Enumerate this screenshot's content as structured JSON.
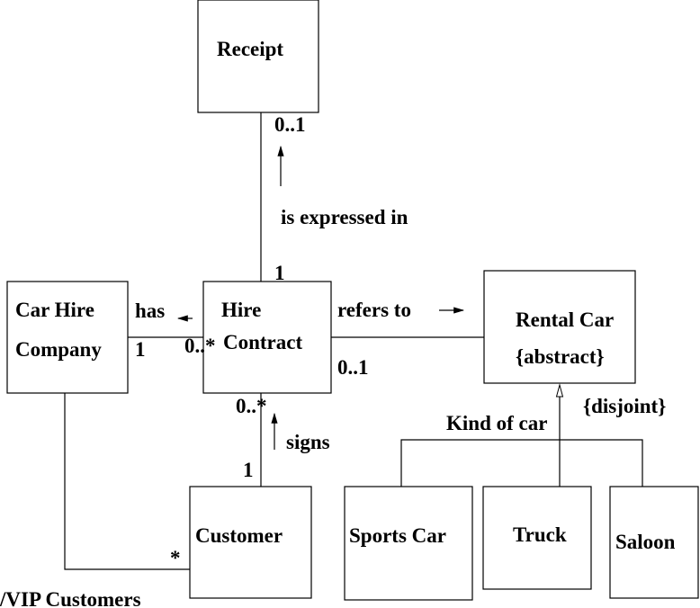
{
  "classes": {
    "receipt": "Receipt",
    "car_hire_company": [
      "Car Hire",
      "Company"
    ],
    "hire_contract": [
      "Hire",
      "Contract"
    ],
    "rental_car": [
      "Rental Car",
      "{abstract}"
    ],
    "customer": "Customer",
    "sports_car": "Sports Car",
    "truck": "Truck",
    "saloon": "Saloon"
  },
  "associations": {
    "expressed": {
      "label": "is expressed in",
      "receipt_mult": "0..1",
      "contract_mult": "1"
    },
    "has": {
      "label": "has",
      "company_mult": "1",
      "contract_mult": "0..*"
    },
    "refers": {
      "label": "refers to",
      "car_mult": "0..1"
    },
    "signs": {
      "label": "signs",
      "contract_mult": "0..*",
      "customer_mult": "1"
    },
    "vip": {
      "label": "/VIP Customers",
      "customer_mult": "*"
    }
  },
  "generalization": {
    "label": "Kind of car",
    "constraint": "{disjoint}"
  }
}
